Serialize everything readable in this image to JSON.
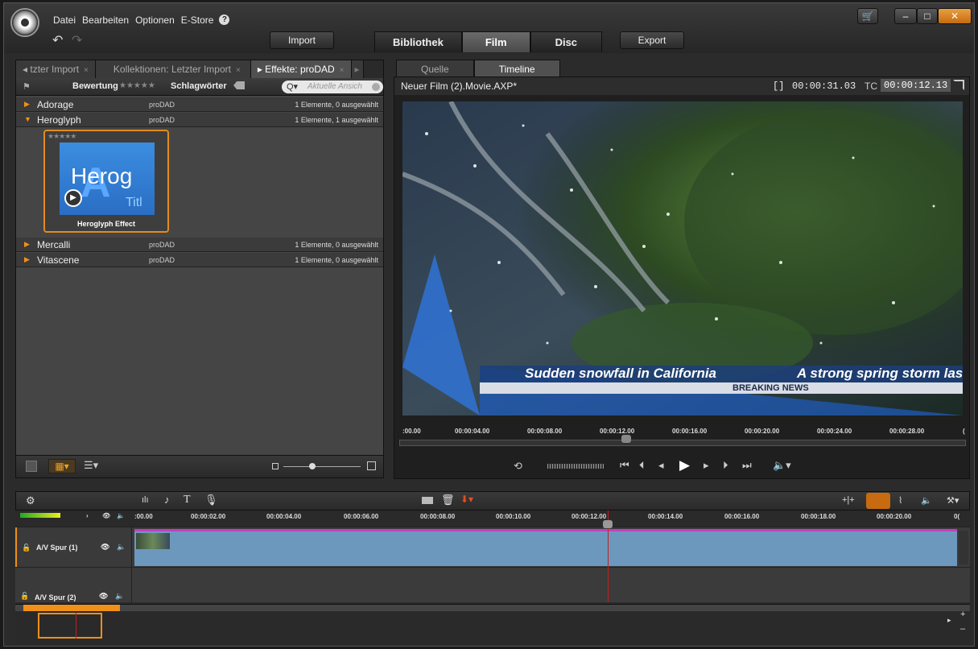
{
  "menu": {
    "items": [
      "Datei",
      "Bearbeiten",
      "Optionen",
      "E-Store"
    ],
    "help": "?"
  },
  "toolbar": {
    "import": "Import",
    "export": "Export",
    "tabs": [
      "Bibliothek",
      "Film",
      "Disc"
    ]
  },
  "library": {
    "tabs": [
      {
        "label": "tzter Import",
        "close": "×"
      },
      {
        "label": "Kollektionen: Letzter Import",
        "close": "×"
      },
      {
        "label": "Effekte: proDAD",
        "close": "×"
      }
    ],
    "filter": {
      "rating_label": "Bewertung",
      "rating_stars": "★★★★★",
      "tags_label": "Schlagwörter",
      "search_placeholder": "Aktuelle Ansich"
    },
    "groups": [
      {
        "name": "Adorage",
        "vendor": "proDAD",
        "count": "1 Elemente, 0 ausgewählt",
        "expanded": false
      },
      {
        "name": "Heroglyph",
        "vendor": "proDAD",
        "count": "1 Elemente, 1 ausgewählt",
        "expanded": true
      },
      {
        "name": "Mercalli",
        "vendor": "proDAD",
        "count": "1 Elemente, 0 ausgewählt",
        "expanded": false
      },
      {
        "name": "Vitascene",
        "vendor": "proDAD",
        "count": "1 Elemente, 0 ausgewählt",
        "expanded": false
      }
    ],
    "thumbnail": {
      "stars": "★★★★★",
      "title_big": "Herog",
      "title_small": "Titl",
      "caption": "Heroglyph Effect"
    }
  },
  "player": {
    "tabs": [
      "Quelle",
      "Timeline"
    ],
    "project": "Neuer Film (2).Movie.AXP*",
    "duration_icon": "[]",
    "duration": "00:00:31.03",
    "tc_label": "TC",
    "timecode": "00:00:12.13",
    "lower_third_left": "Sudden snowfall in California",
    "lower_third_right": "A strong spring storm las",
    "breaking": "BREAKING NEWS",
    "ruler": [
      ":00.00",
      "00:00:04.00",
      "00:00:08.00",
      "00:00:12.00",
      "00:00:16.00",
      "00:00:20.00",
      "00:00:24.00",
      "00:00:28.00",
      "("
    ]
  },
  "timeline": {
    "ruler": [
      ":00.00",
      "00:00:02.00",
      "00:00:04.00",
      "00:00:06.00",
      "00:00:08.00",
      "00:00:10.00",
      "00:00:12.00",
      "00:00:14.00",
      "00:00:16.00",
      "00:00:18.00",
      "00:00:20.00",
      "0("
    ],
    "tracks": [
      "A/V Spur (1)",
      "A/V Spur (2)"
    ],
    "accent": "#f0901a"
  },
  "icons": [
    "logo-icon",
    "undo-icon",
    "redo-icon",
    "cart-icon",
    "minimize-icon",
    "maximize-icon",
    "close-icon",
    "search-icon",
    "play-icon",
    "rewind-icon",
    "fastforward-icon",
    "volume-icon",
    "lock-icon",
    "eye-icon",
    "speaker-icon",
    "trash-icon",
    "marker-icon",
    "magnet-icon",
    "gear-icon"
  ]
}
